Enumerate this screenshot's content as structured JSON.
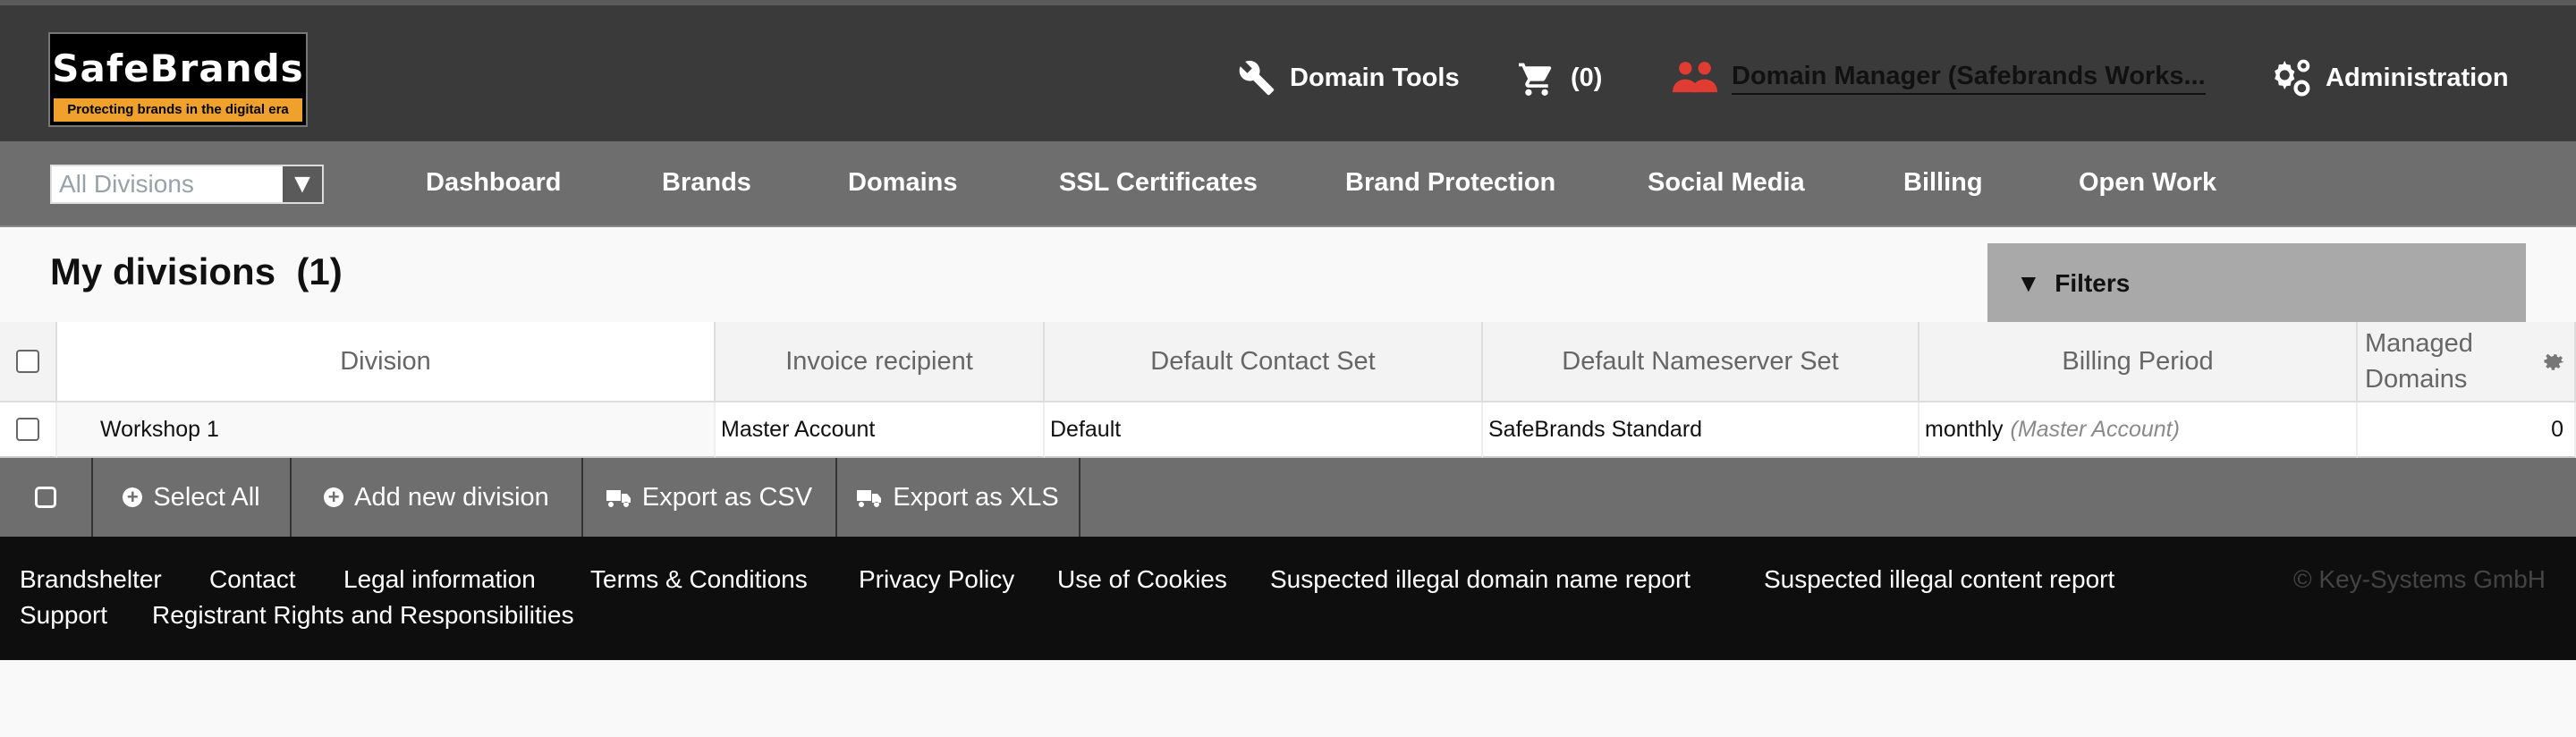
{
  "header": {
    "logo_name": "SafeBrands",
    "logo_tagline": "Protecting brands in the digital era",
    "domain_tools": "Domain Tools",
    "cart_count": "(0)",
    "domain_manager": "Domain Manager (Safebrands Works...",
    "administration": "Administration"
  },
  "nav": {
    "division_select": "All Divisions",
    "items": [
      "Dashboard",
      "Brands",
      "Domains",
      "SSL Certificates",
      "Brand Protection",
      "Social Media",
      "Billing",
      "Open Work"
    ]
  },
  "page": {
    "title": "My divisions",
    "count": "(1)",
    "filters": "Filters"
  },
  "table": {
    "headers": [
      "Division",
      "Invoice recipient",
      "Default Contact Set",
      "Default Nameserver Set",
      "Billing Period",
      "Managed Domains"
    ],
    "rows": [
      {
        "division": "Workshop 1",
        "invoice_recipient": "Master Account",
        "contact_set": "Default",
        "nameserver_set": "SafeBrands Standard",
        "billing_period": "monthly",
        "billing_note": "(Master Account)",
        "managed_domains": "0"
      }
    ]
  },
  "actions": {
    "select_all": "Select All",
    "add_division": "Add new division",
    "export_csv": "Export as CSV",
    "export_xls": "Export as XLS"
  },
  "footer": {
    "links": [
      "Brandshelter",
      "Contact",
      "Legal information",
      "Terms & Conditions",
      "Privacy Policy",
      "Use of Cookies",
      "Suspected illegal domain name report",
      "Suspected illegal content report",
      "Support",
      "Registrant Rights and Responsibilities"
    ],
    "copyright": "© Key-Systems GmbH"
  },
  "colors": {
    "header_bg": "#3a3a3a",
    "nav_bg": "#6e6e6e",
    "footer_bg": "#0e0e0e",
    "logo_accent": "#f0a12b",
    "user_icon": "#e03c31"
  }
}
